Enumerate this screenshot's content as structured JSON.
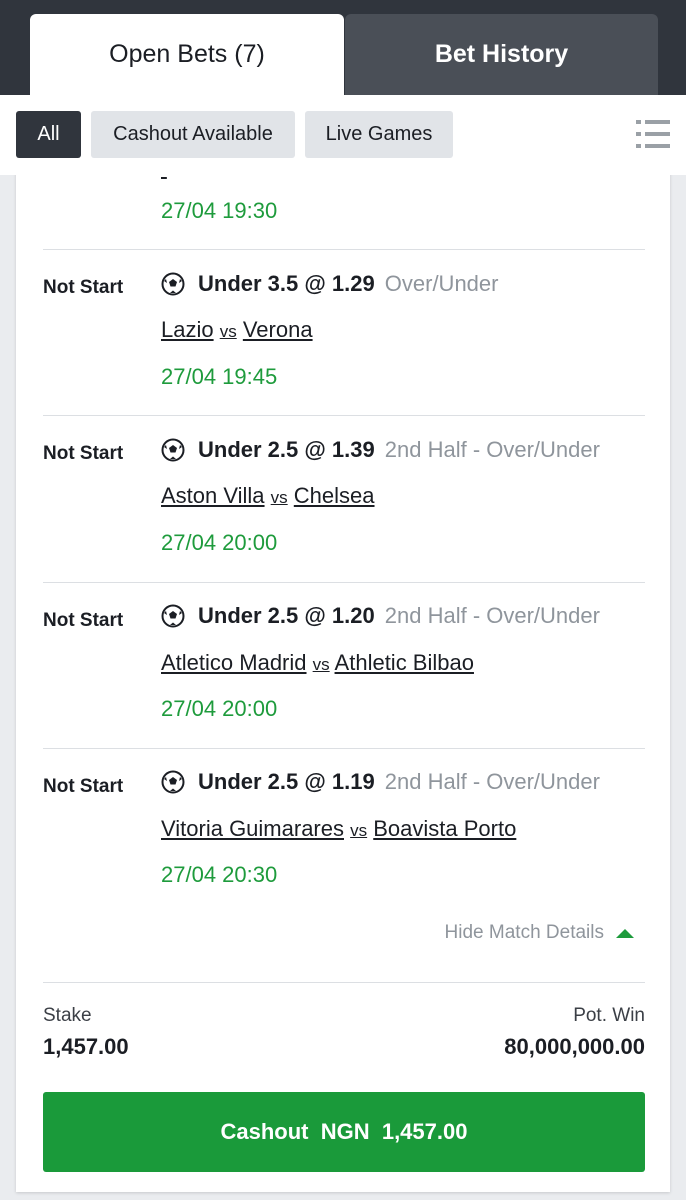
{
  "tabs": {
    "open_bets": "Open Bets (7)",
    "bet_history": "Bet History"
  },
  "filters": {
    "all": "All",
    "cashout_available": "Cashout Available",
    "live_games": "Live Games",
    "menu_icon": "list-icon"
  },
  "bet": {
    "previous_date": "27/04 19:30",
    "selections": [
      {
        "status": "Not Start",
        "pick": "Under 3.5 @ 1.29",
        "market": "Over/Under",
        "home": "Lazio",
        "vs": "vs",
        "away": "Verona",
        "datetime": "27/04 19:45"
      },
      {
        "status": "Not Start",
        "pick": "Under 2.5 @ 1.39",
        "market": "2nd Half - Over/Under",
        "home": "Aston Villa",
        "vs": "vs",
        "away": "Chelsea",
        "datetime": "27/04 20:00"
      },
      {
        "status": "Not Start",
        "pick": "Under 2.5 @ 1.20",
        "market": "2nd Half - Over/Under",
        "home": "Atletico Madrid",
        "vs": "vs",
        "away": "Athletic Bilbao",
        "datetime": "27/04 20:00"
      },
      {
        "status": "Not Start",
        "pick": "Under 2.5 @ 1.19",
        "market": "2nd Half - Over/Under",
        "home": "Vitoria Guimarares",
        "vs": "vs",
        "away": "Boavista Porto",
        "datetime": "27/04 20:30"
      }
    ],
    "hide_details": "Hide Match Details",
    "stake_label": "Stake",
    "stake_value": "1,457.00",
    "pot_win_label": "Pot. Win",
    "pot_win_value": "80,000,000.00",
    "cashout_label": "Cashout  NGN  1,457.00"
  },
  "colors": {
    "green": "#1e9b3c",
    "dark": "#30353d",
    "grey_text": "#8f959c"
  }
}
